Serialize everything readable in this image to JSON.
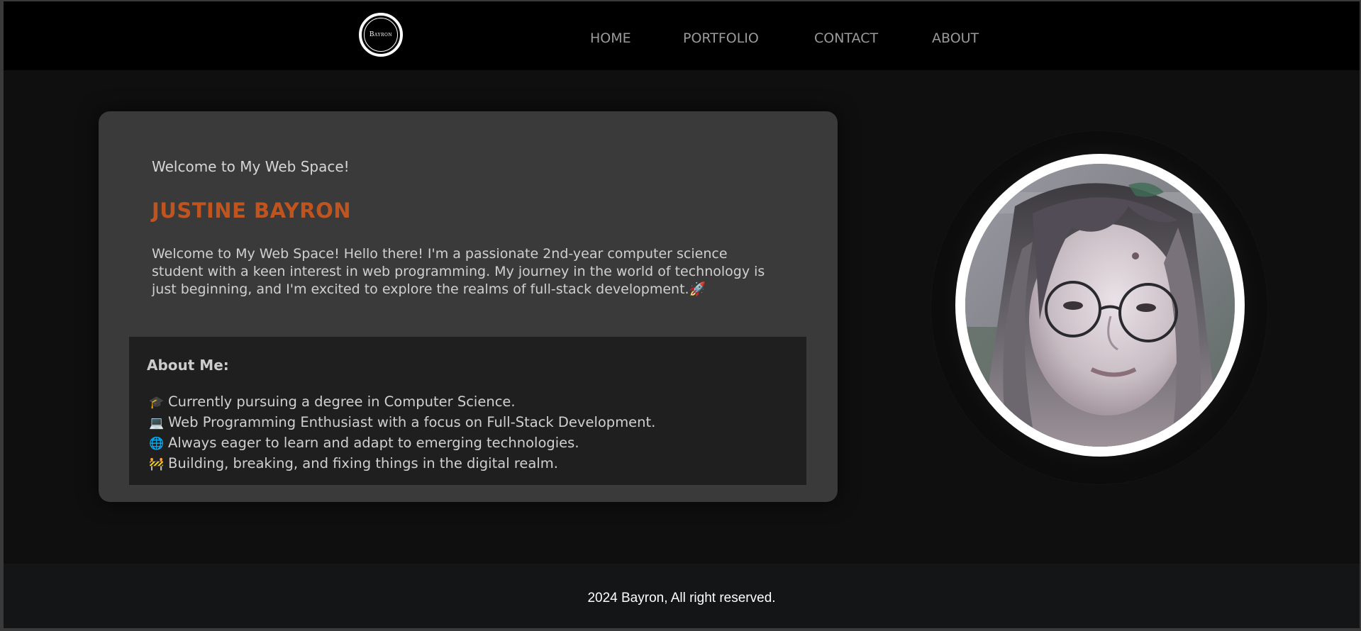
{
  "header": {
    "logo_text": "Bayron",
    "nav": [
      {
        "label": "HOME"
      },
      {
        "label": "PORTFOLIO"
      },
      {
        "label": "CONTACT"
      },
      {
        "label": "ABOUT"
      }
    ]
  },
  "main": {
    "greeting": "Welcome to My Web Space!",
    "name": "JUSTINE BAYRON",
    "intro": "Welcome to My Web Space! Hello there! I'm a passionate 2nd-year computer science student with a keen interest in web programming. My journey in the world of technology is just beginning, and I'm excited to explore the realms of full-stack development.",
    "intro_icon": "🚀",
    "about": {
      "title": "About Me:",
      "items": [
        {
          "icon": "🎓",
          "text": "Currently pursuing a degree in Computer Science."
        },
        {
          "icon": "💻",
          "text": "Web Programming Enthusiast with a focus on Full-Stack Development."
        },
        {
          "icon": "🌐",
          "text": "Always eager to learn and adapt to emerging technologies."
        },
        {
          "icon": "🚧",
          "text": "Building, breaking, and fixing things in the digital realm."
        }
      ]
    }
  },
  "footer": {
    "text": "2024 Bayron, All right reserved."
  },
  "colors": {
    "accent": "#c0541e",
    "background": "#0f0f0f",
    "card": "#3a3a3a",
    "about_box": "#1f1f1f",
    "header": "#000000",
    "footer": "#141517"
  }
}
